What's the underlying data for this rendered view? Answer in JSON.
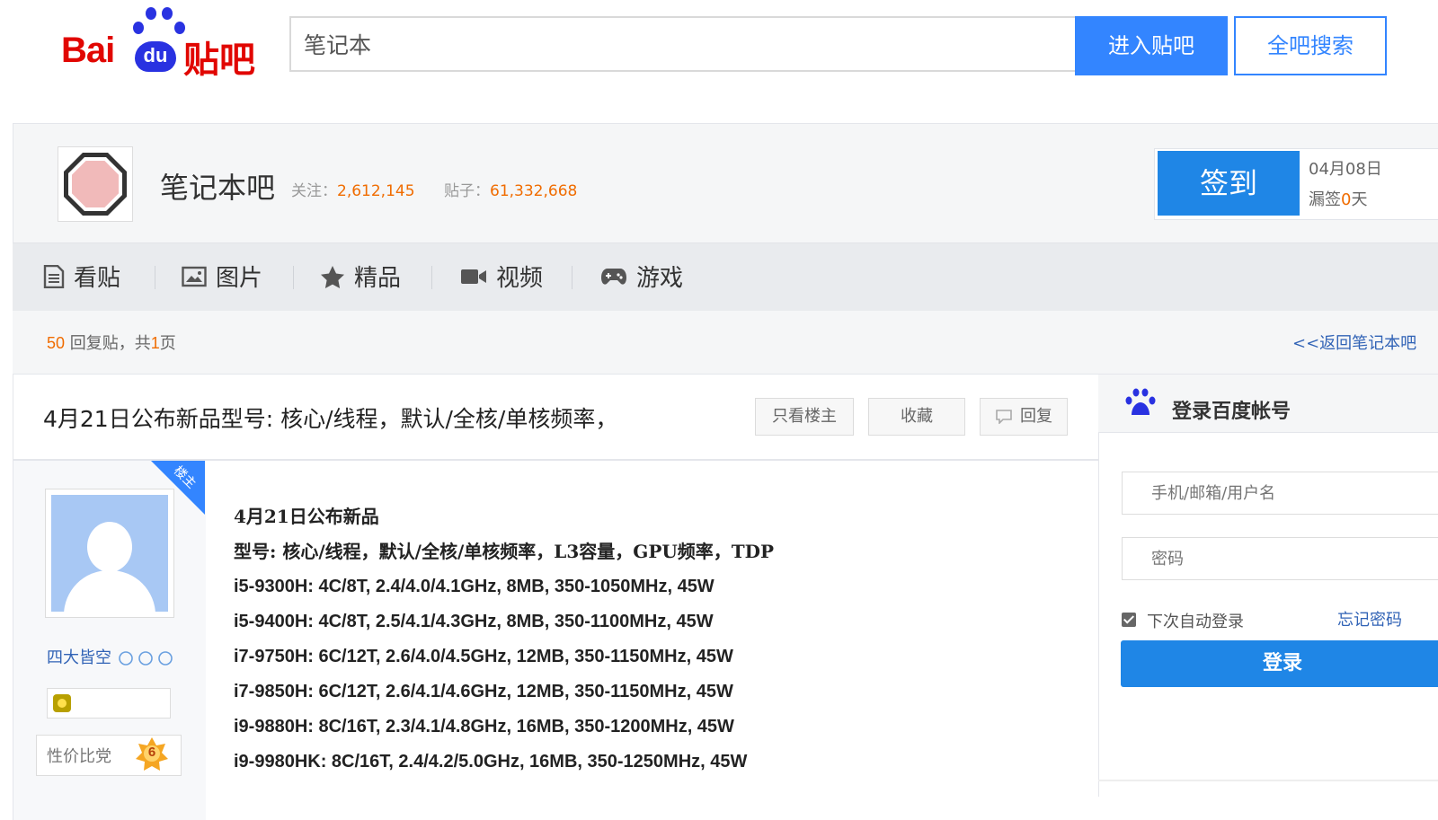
{
  "header": {
    "logo_bai": "Bai",
    "logo_du": "du",
    "logo_tieba": "贴吧",
    "search_value": "笔记本",
    "enter_button": "进入贴吧",
    "search_all_button": "全吧搜索"
  },
  "forum": {
    "name": "笔记本吧",
    "follow_label": "关注：",
    "follow_count": "2,612,145",
    "posts_label": "贴子：",
    "posts_count": "61,332,668",
    "signin_button": "签到",
    "sign_date": "04月08日",
    "miss_prefix": "漏签",
    "miss_days": "0",
    "miss_suffix": "天"
  },
  "nav": {
    "tabs": [
      {
        "label": "看贴",
        "icon": "document-icon"
      },
      {
        "label": "图片",
        "icon": "image-icon"
      },
      {
        "label": "精品",
        "icon": "star-icon"
      },
      {
        "label": "视频",
        "icon": "video-camera-icon"
      },
      {
        "label": "游戏",
        "icon": "gamepad-icon"
      }
    ]
  },
  "reply_bar": {
    "reply_count": "50",
    "reply_text": "回复贴，共",
    "page_count": "1",
    "page_suffix": "页",
    "back_link": "<<返回笔记本吧"
  },
  "thread": {
    "title": "4月21日公布新品型号: 核心/线程，默认/全核/单核频率，",
    "only_op_button": "只看楼主",
    "favorite_button": "收藏",
    "reply_button": "回复"
  },
  "post": {
    "op_badge": "楼主",
    "username": "四大皆空",
    "level_name": "性价比党",
    "level": "6",
    "lines": [
      "4月21日公布新品",
      "型号: 核心/线程，默认/全核/单核频率，L3容量，GPU频率，TDP",
      "i5-9300H: 4C/8T, 2.4/4.0/4.1GHz, 8MB, 350-1050MHz, 45W",
      "i5-9400H: 4C/8T, 2.5/4.1/4.3GHz, 8MB, 350-1100MHz, 45W",
      "i7-9750H: 6C/12T, 2.6/4.0/4.5GHz, 12MB, 350-1150MHz, 45W",
      "i7-9850H: 6C/12T, 2.6/4.1/4.6GHz, 12MB, 350-1150MHz, 45W",
      "i9-9880H: 8C/16T, 2.3/4.1/4.8GHz, 16MB, 350-1200MHz, 45W",
      "i9-9980HK: 8C/16T, 2.4/4.2/5.0GHz, 16MB, 350-1250MHz, 45W"
    ]
  },
  "login": {
    "title": "登录百度帐号",
    "username_placeholder": "手机/邮箱/用户名",
    "password_placeholder": "密码",
    "remember_label": "下次自动登录",
    "remember_checked": true,
    "forgot_link": "忘记密码",
    "login_button": "登录"
  },
  "colors": {
    "brand_blue": "#3385ff",
    "button_blue": "#1f86e6",
    "brand_red": "#e10601",
    "accent_orange": "#f06c00",
    "link_blue": "#3163b6"
  }
}
